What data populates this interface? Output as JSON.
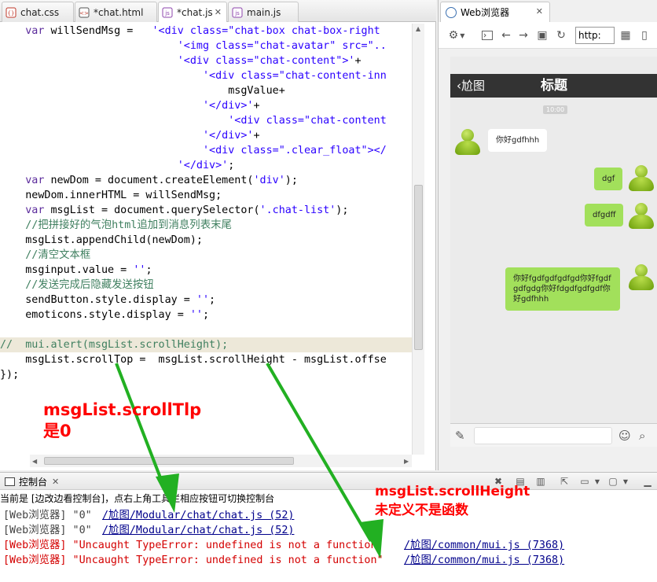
{
  "editor": {
    "tabs": [
      {
        "label": "chat.css",
        "icon": "css-file-icon"
      },
      {
        "label": "*chat.html",
        "icon": "html-file-icon"
      },
      {
        "label": "*chat.js",
        "icon": "js-file-icon",
        "active": true
      },
      {
        "label": "main.js",
        "icon": "js-file-icon"
      }
    ],
    "close_glyph": "✕",
    "code_lines": [
      [
        {
          "t": "    "
        },
        {
          "t": "var",
          "c": "k"
        },
        {
          "t": " willSendMsg =   "
        },
        {
          "t": "'<div class=\"chat-box chat-box-right",
          "c": "s"
        }
      ],
      [
        {
          "t": "                            "
        },
        {
          "t": "'<img class=\"chat-avatar\" src=\"..",
          "c": "s"
        }
      ],
      [
        {
          "t": "                            "
        },
        {
          "t": "'<div class=\"chat-content\">'",
          "c": "s"
        },
        {
          "t": "+"
        }
      ],
      [
        {
          "t": "                                "
        },
        {
          "t": "'<div class=\"chat-content-inn",
          "c": "s"
        }
      ],
      [
        {
          "t": "                                    msgValue+"
        }
      ],
      [
        {
          "t": "                                "
        },
        {
          "t": "'</div>'",
          "c": "s"
        },
        {
          "t": "+"
        }
      ],
      [
        {
          "t": "                                    "
        },
        {
          "t": "'<div class=\"chat-content",
          "c": "s"
        }
      ],
      [
        {
          "t": "                                "
        },
        {
          "t": "'</div>'",
          "c": "s"
        },
        {
          "t": "+"
        }
      ],
      [
        {
          "t": "                                "
        },
        {
          "t": "'<div class=\".clear_float\"></",
          "c": "s"
        }
      ],
      [
        {
          "t": "                            "
        },
        {
          "t": "'</div>'",
          "c": "s"
        },
        {
          "t": ";"
        }
      ],
      [
        {
          "t": "    "
        },
        {
          "t": "var",
          "c": "k"
        },
        {
          "t": " newDom = document.createElement("
        },
        {
          "t": "'div'",
          "c": "s"
        },
        {
          "t": ");"
        }
      ],
      [
        {
          "t": "    newDom.innerHTML = willSendMsg;"
        }
      ],
      [
        {
          "t": "    "
        },
        {
          "t": "var",
          "c": "k"
        },
        {
          "t": " msgList = document.querySelector("
        },
        {
          "t": "'.chat-list'",
          "c": "s"
        },
        {
          "t": ");"
        }
      ],
      [
        {
          "t": "    "
        },
        {
          "t": "//把拼接好的气泡html追加到消息列表末尾",
          "c": "c"
        }
      ],
      [
        {
          "t": "    msgList.appendChild(newDom);"
        }
      ],
      [
        {
          "t": "    "
        },
        {
          "t": "//清空文本框",
          "c": "c"
        }
      ],
      [
        {
          "t": "    msginput.value = "
        },
        {
          "t": "''",
          "c": "s"
        },
        {
          "t": ";"
        }
      ],
      [
        {
          "t": "    "
        },
        {
          "t": "//发送完成后隐藏发送按钮",
          "c": "c"
        }
      ],
      [
        {
          "t": "    sendButton.style.display = "
        },
        {
          "t": "''",
          "c": "s"
        },
        {
          "t": ";"
        }
      ],
      [
        {
          "t": "    emoticons.style.display = "
        },
        {
          "t": "''",
          "c": "s"
        },
        {
          "t": ";"
        }
      ],
      [
        {
          "t": ""
        }
      ],
      [
        {
          "t": "//  mui.alert(msgList.scrollHeight);",
          "c": "c"
        }
      ],
      [
        {
          "t": "    msgList.scrollTop =  msgList.scrollHeight - msgList.offse"
        }
      ],
      [
        {
          "t": "});"
        }
      ]
    ],
    "highlight_line": 21
  },
  "browser": {
    "tab_label": "Web浏览器",
    "url_text": "http:",
    "phone": {
      "back_label": "尬图",
      "title": "标题",
      "time": "10:00",
      "messages": [
        {
          "side": "left",
          "text": "你好gdfhhh"
        },
        {
          "side": "right",
          "text": "dgf"
        },
        {
          "side": "right",
          "text": "dfgdff"
        },
        {
          "side": "right",
          "text": "你好fgdfgdfgdfgd你好fgdfgdfgdg你好fdgdfgdfgdf你好gdfhhh"
        }
      ]
    }
  },
  "console": {
    "tab_label": "控制台",
    "hint": "当前是 [边改边看控制台]，点右上角工具栏相应按钮可切换控制台",
    "lines": [
      {
        "type": "info",
        "text": "[Web浏览器] \"0\"",
        "link": "/尬图/Modular/chat/chat.js (52)"
      },
      {
        "type": "info",
        "text": "[Web浏览器] \"0\"",
        "link": "/尬图/Modular/chat/chat.js (52)"
      },
      {
        "type": "err",
        "text": "[Web浏览器] \"Uncaught TypeError: undefined is not a function\"",
        "link": "/尬图/common/mui.js (7368)"
      },
      {
        "type": "err",
        "text": "[Web浏览器] \"Uncaught TypeError: undefined is not a function\"",
        "link": "/尬图/common/mui.js (7368)"
      }
    ]
  },
  "annotations": {
    "note1_line1": "msgList.scrollTlp",
    "note1_line2": "是0",
    "note2_line1": "msgList.scrollHeight",
    "note2_line2": "未定义不是函数",
    "color_text": "#ff0000",
    "color_arrow": "#22b022"
  }
}
